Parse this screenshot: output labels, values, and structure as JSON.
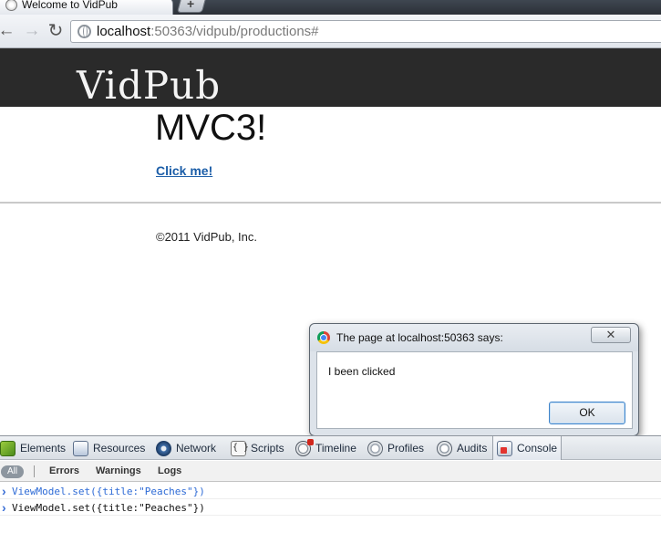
{
  "browser": {
    "tab_title": "Welcome to VidPub",
    "url_host": "localhost",
    "url_rest": ":50363/vidpub/productions#"
  },
  "page": {
    "logo": "VidPub",
    "headline": "MVC3!",
    "link_text": "Click me!",
    "footer": "©2011 VidPub, Inc."
  },
  "dialog": {
    "title": "The page at localhost:50363 says:",
    "message": "I been clicked",
    "ok_label": "OK"
  },
  "devtools": {
    "tabs": [
      {
        "label": "Elements",
        "icon": "elements-icon"
      },
      {
        "label": "Resources",
        "icon": "resources-icon"
      },
      {
        "label": "Network",
        "icon": "network-icon"
      },
      {
        "label": "Scripts",
        "icon": "scripts-icon"
      },
      {
        "label": "Timeline",
        "icon": "timeline-icon"
      },
      {
        "label": "Profiles",
        "icon": "profiles-icon"
      },
      {
        "label": "Audits",
        "icon": "audits-icon"
      },
      {
        "label": "Console",
        "icon": "console-icon"
      }
    ],
    "filters": {
      "all": "All",
      "errors": "Errors",
      "warnings": "Warnings",
      "logs": "Logs"
    },
    "console_lines": [
      "ViewModel.set({title:\"Peaches\"})",
      "ViewModel.set({title:\"Peaches\"})"
    ]
  },
  "colors": {
    "header_bg": "#2a2a2a",
    "link": "#1c5ea8",
    "console_input": "#2e6bd6"
  }
}
